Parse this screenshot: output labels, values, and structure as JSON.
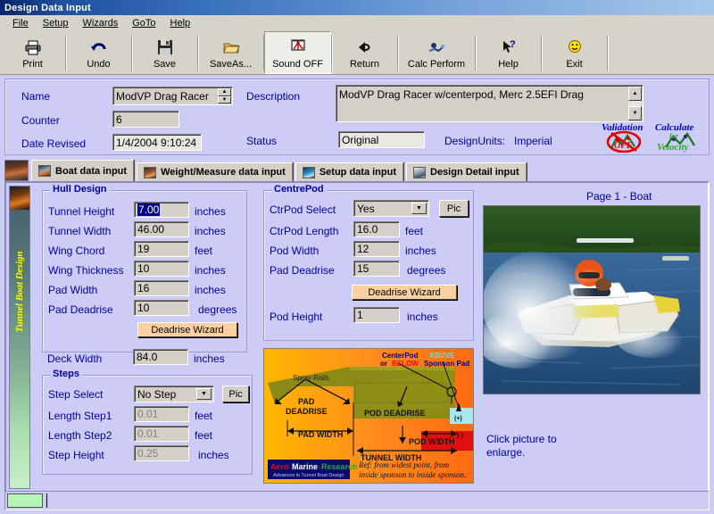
{
  "window": {
    "title": "Design Data Input"
  },
  "menubar": {
    "items": [
      {
        "label": "File",
        "accel": "F"
      },
      {
        "label": "Setup",
        "accel": "S"
      },
      {
        "label": "Wizards",
        "accel": "W"
      },
      {
        "label": "GoTo",
        "accel": "G"
      },
      {
        "label": "Help",
        "accel": "H"
      }
    ]
  },
  "toolbar": {
    "buttons": [
      {
        "label": "Print",
        "icon": "printer-icon",
        "glyph": "🖨"
      },
      {
        "label": "Undo",
        "icon": "undo-arrow-icon",
        "glyph": "↰"
      },
      {
        "label": "Save",
        "icon": "floppy-disk-icon",
        "glyph": "💾"
      },
      {
        "label": "SaveAs...",
        "icon": "save-as-folder-icon",
        "glyph": "📂"
      },
      {
        "label": "Sound OFF",
        "icon": "sound-off-icon",
        "glyph": "🔇",
        "pressed": true
      },
      {
        "label": "Return",
        "icon": "return-arrow-icon",
        "glyph": "◀"
      },
      {
        "label": "Calc Perform",
        "icon": "calc-perform-icon",
        "glyph": "⚙"
      },
      {
        "label": "Help",
        "icon": "help-pointer-icon",
        "glyph": "↖"
      },
      {
        "label": "Exit",
        "icon": "exit-smiley-icon",
        "glyph": "☺"
      }
    ]
  },
  "header": {
    "name_label": "Name",
    "name_value": "ModVP Drag Racer",
    "counter_label": "Counter",
    "counter_value": "6",
    "date_label": "Date Revised",
    "date_value": "1/4/2004 9:10:24",
    "description_label": "Description",
    "description_value": "ModVP Drag Racer w/centerpod, Merc 2.5EFI Drag",
    "status_label": "Status",
    "status_value": "Original",
    "units_label": "DesignUnits:",
    "units_value": "Imperial",
    "validation_word1": "Validation",
    "validation_word2": "OFF",
    "calculate_word1": "Calculate",
    "calculate_word2": "for",
    "calculate_word3": "Velocity"
  },
  "tabs": [
    {
      "label": "Boat data input",
      "active": true,
      "icon": "boat-tab-icon"
    },
    {
      "label": "Weight/Measure data input",
      "active": false,
      "icon": "weight-tab-icon"
    },
    {
      "label": "Setup data input",
      "active": false,
      "icon": "setup-tab-icon"
    },
    {
      "label": "Design Detail input",
      "active": false,
      "icon": "detail-tab-icon"
    }
  ],
  "sidebar": {
    "vertical_text": "Tunnel Boat Design"
  },
  "hull_design": {
    "title": "Hull Design",
    "rows": [
      {
        "label": "Tunnel Height",
        "value": "7.00",
        "unit": "inches",
        "selected": true,
        "disabled": false
      },
      {
        "label": "Tunnel Width",
        "value": "46.00",
        "unit": "inches",
        "selected": false,
        "disabled": false
      },
      {
        "label": "Wing Chord",
        "value": "19",
        "unit": "feet",
        "selected": false,
        "disabled": false
      },
      {
        "label": "Wing Thickness",
        "value": "10",
        "unit": "inches",
        "selected": false,
        "disabled": false
      },
      {
        "label": "Pad Width",
        "value": "16",
        "unit": "inches",
        "selected": false,
        "disabled": false
      },
      {
        "label": "Pad Deadrise",
        "value": "10",
        "unit": "degrees",
        "selected": false,
        "disabled": false
      }
    ],
    "wizard_button": "Deadrise Wizard",
    "deck_label": "Deck Width",
    "deck_value": "84.0",
    "deck_unit": "inches"
  },
  "steps": {
    "title": "Steps",
    "select_label": "Step Select",
    "select_value": "No Step",
    "pic_button": "Pic",
    "rows": [
      {
        "label": "Length Step1",
        "value": "0.01",
        "unit": "feet",
        "disabled": true
      },
      {
        "label": "Length Step2",
        "value": "0.01",
        "unit": "feet",
        "disabled": true
      },
      {
        "label": "Step Height",
        "value": "0.25",
        "unit": "inches",
        "disabled": true
      }
    ]
  },
  "centrepod": {
    "title": "CentrePod",
    "select_label": "CtrPod Select",
    "select_value": "Yes",
    "pic_button": "Pic",
    "rows": [
      {
        "label": "CtrPod Length",
        "value": "16.0",
        "unit": "feet"
      },
      {
        "label": "Pod Width",
        "value": "12",
        "unit": "inches"
      },
      {
        "label": "Pad Deadrise",
        "value": "15",
        "unit": "degrees"
      }
    ],
    "wizard_button": "Deadrise Wizard",
    "height_label": "Pod Height",
    "height_value": "1",
    "height_unit": "inches"
  },
  "diagram": {
    "name": "hull-cross-section-diagram",
    "labels": {
      "centerpod_line1_a": "CenterPod ",
      "centerpod_line1_b": "ABOVE",
      "centerpod_line2_a": "or ",
      "centerpod_line2_b": "BELOW",
      "centerpod_line2_c": " Sponson Pad",
      "spray_rails": "Spray Rails",
      "pad_deadrise_1": "PAD",
      "pad_deadrise_2": "DEADRISE",
      "pod_deadrise": "POD DEADRISE",
      "pad_width": "PAD WIDTH",
      "pod_width": "POD WIDTH",
      "tunnel_width": "TUNNEL WIDTH",
      "plus": "(+)",
      "minus": "(-)",
      "ref_line1": "Ref: from widest point, from",
      "ref_line2": "inside sponson to inside sponson.",
      "logo_a": "Aero",
      "logo_b": "Marine",
      "logo_c": " Research",
      "logo_sub": "Advances in Tunnel Boat Design"
    }
  },
  "right_panel": {
    "page_label": "Page 1 - Boat",
    "photo_name": "tunnel-boat-action-photo",
    "click_note_line1": "Click picture to",
    "click_note_line2": "enlarge."
  },
  "colors": {
    "form_background": "#ccccf7",
    "label_blue": "#00009c",
    "field_face": "#d4d0c8",
    "toolbar_face": "#d6d3c8",
    "wizard_button": "#fcd0a0",
    "diagram_orange": "#ff8a1e",
    "sidebar_text": "#ffff00",
    "selection_blue": "#000080",
    "status_green": "#b6f5b6"
  }
}
